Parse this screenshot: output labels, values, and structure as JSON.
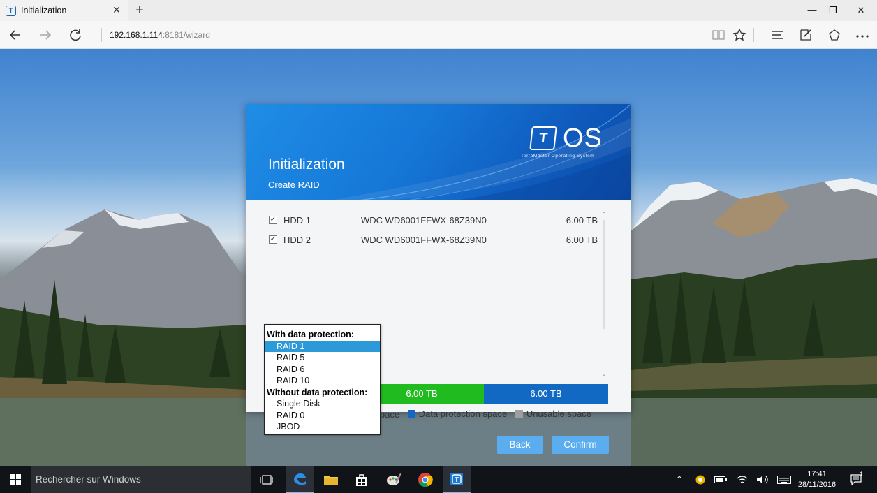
{
  "browser": {
    "tab_title": "Initialization",
    "tab_close": "✕",
    "new_tab": "+",
    "url_host": "192.168.1.114",
    "url_rest": ":8181/wizard",
    "window_controls": {
      "minimize": "—",
      "maximize": "❐",
      "close": "✕"
    },
    "icons": [
      "back-arrow-icon",
      "forward-arrow-icon",
      "refresh-icon",
      "reading-view-icon",
      "favorite-star-icon",
      "hub-icon",
      "web-note-icon",
      "share-icon",
      "more-icon"
    ]
  },
  "dialog": {
    "title": "Initialization",
    "subtitle": "Create RAID",
    "logo_text": "OS",
    "logo_letter": "T",
    "logo_tagline": "TerraMaster Operating System",
    "disks": [
      {
        "name": "HDD 1",
        "model": "WDC WD6001FFWX-68Z39N0",
        "size": "6.00 TB",
        "checked": true
      },
      {
        "name": "HDD 2",
        "model": "WDC WD6001FFWX-68Z39N0",
        "size": "6.00 TB",
        "checked": true
      }
    ],
    "capacity_bar": [
      {
        "label": "6.00 TB",
        "kind": "free",
        "color": "#1fbb1f",
        "fraction": 0.5
      },
      {
        "label": "6.00 TB",
        "kind": "protection",
        "color": "#1269c4",
        "fraction": 0.5
      }
    ],
    "legend": [
      {
        "label": "ree space",
        "color": "#1fbb1f"
      },
      {
        "label": "Data protection space",
        "color": "#1269c4"
      },
      {
        "label": "Unusable space",
        "color": "#9e9e9e"
      }
    ],
    "back_label": "Back",
    "confirm_label": "Confirm"
  },
  "raid_dropdown": {
    "group_protected": "With data protection:",
    "protected_options": [
      "RAID 1",
      "RAID 5",
      "RAID 6",
      "RAID 10"
    ],
    "selected": "RAID 1",
    "group_unprotected": "Without data protection:",
    "unprotected_options": [
      "Single Disk",
      "RAID 0",
      "JBOD"
    ]
  },
  "taskbar": {
    "search_placeholder": "Rechercher sur Windows",
    "time": "17:41",
    "date": "28/11/2016",
    "notification_count": "1",
    "apps": [
      "task-view-icon",
      "edge-icon",
      "file-explorer-icon",
      "store-icon",
      "paint-icon",
      "chrome-icon",
      "terramaster-icon"
    ]
  }
}
